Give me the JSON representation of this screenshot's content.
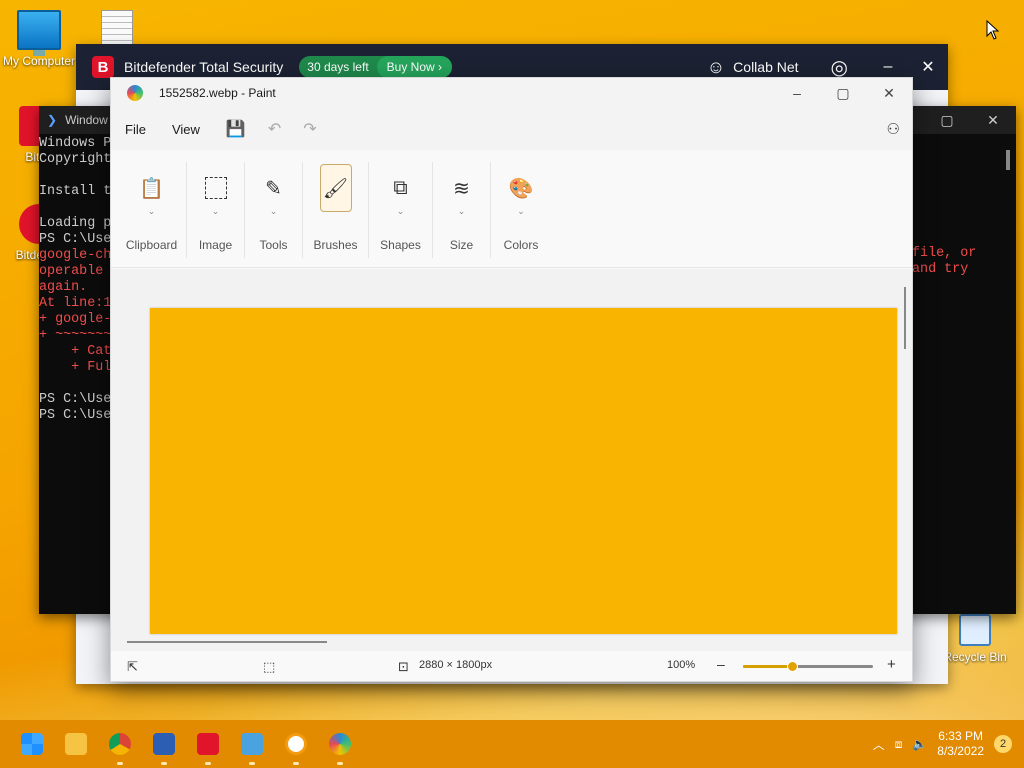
{
  "desktop": {
    "icons": [
      {
        "label": "My Computer"
      },
      {
        "label": ""
      },
      {
        "label": "Bitde"
      },
      {
        "label": "Bitde VP"
      },
      {
        "label": "Recycle Bin"
      }
    ]
  },
  "bitdefender": {
    "title": "Bitdefender Total Security",
    "days_left": "30 days left",
    "buy_now": "Buy Now",
    "user": "Collab Net"
  },
  "terminal": {
    "title": "Window",
    "lines": [
      "Windows P",
      "Copyright",
      "",
      "Install t",
      "",
      "Loading p",
      "PS C:\\Use",
      "google-ch",
      "operable ",
      "again.",
      "At line:1",
      "+ google-",
      "+ ~~~~~~~",
      "    + Cat",
      "    + Ful",
      "",
      "PS C:\\Use",
      "PS C:\\Use"
    ],
    "red_from": 7,
    "red_to": 14,
    "right_lines": [
      "file, or",
      "and try"
    ]
  },
  "paint": {
    "title": "1552582.webp - Paint",
    "menu": {
      "file": "File",
      "view": "View"
    },
    "groups": [
      {
        "label": "Clipboard",
        "icon": "clipboard-icon"
      },
      {
        "label": "Image",
        "icon": "selection-icon"
      },
      {
        "label": "Tools",
        "icon": "tools-icon"
      },
      {
        "label": "Brushes",
        "icon": "brush-icon"
      },
      {
        "label": "Shapes",
        "icon": "shapes-icon"
      },
      {
        "label": "Size",
        "icon": "size-icon"
      },
      {
        "label": "Colors",
        "icon": "palette-icon"
      }
    ],
    "image_color": "#f8b400",
    "status": {
      "dimensions": "2880 × 1800px",
      "zoom": "100%",
      "zoom_fraction": 0.38
    }
  },
  "taskbar": {
    "time": "6:33 PM",
    "date": "8/3/2022",
    "notifications": "2"
  }
}
